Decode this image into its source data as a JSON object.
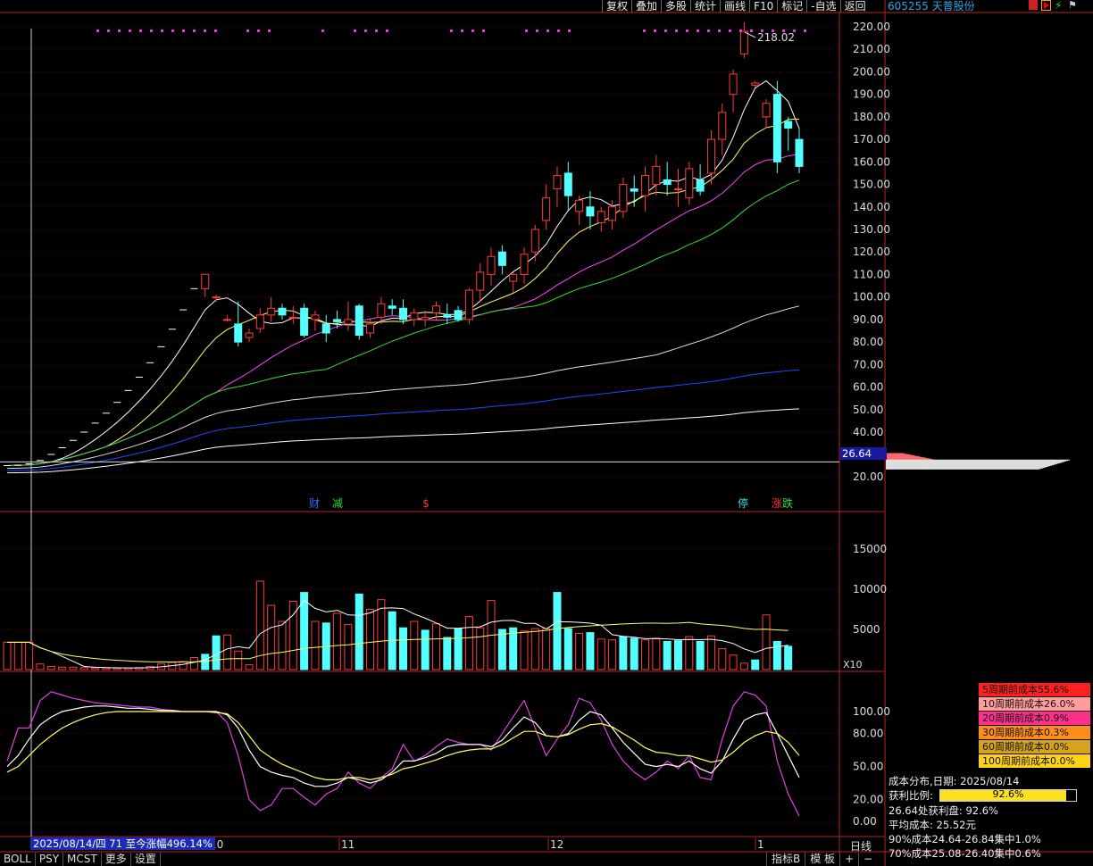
{
  "toolbar": {
    "items": [
      "复权",
      "叠加",
      "多股",
      "统计",
      "画线",
      "F10",
      "标记",
      "-自选",
      "返回"
    ]
  },
  "stock": {
    "title": "605255 天普股份"
  },
  "chart_data": [
    {
      "type": "candlestick",
      "name": "price",
      "yticks": [
        20,
        40,
        50,
        60,
        70,
        80,
        90,
        100,
        110,
        120,
        130,
        140,
        150,
        160,
        170,
        180,
        190,
        200,
        210,
        220
      ],
      "ylim": [
        15,
        225
      ],
      "high_label": "218.02",
      "current_price": "26.64",
      "events": [
        "财",
        "减",
        "$",
        "停",
        "涨",
        "跌"
      ],
      "candles": [
        [
          24.5,
          25.2,
          24.1,
          25.0
        ],
        [
          25.0,
          25.5,
          24.6,
          25.2
        ],
        [
          25.2,
          26.0,
          25.0,
          25.8
        ],
        [
          25.8,
          27.5,
          25.5,
          27.3
        ],
        [
          27.3,
          30.0,
          27.2,
          30.0
        ],
        [
          30.0,
          33.0,
          30.0,
          33.0
        ],
        [
          33.0,
          36.3,
          33.0,
          36.3
        ],
        [
          36.3,
          40.0,
          36.3,
          40.0
        ],
        [
          40.0,
          44.0,
          40.0,
          44.0
        ],
        [
          44.0,
          48.4,
          44.0,
          48.4
        ],
        [
          48.4,
          53.2,
          48.4,
          53.2
        ],
        [
          53.2,
          58.5,
          53.2,
          58.5
        ],
        [
          58.5,
          64.4,
          58.5,
          64.4
        ],
        [
          64.4,
          70.8,
          64.4,
          70.8
        ],
        [
          70.8,
          77.9,
          70.8,
          77.9
        ],
        [
          77.9,
          85.7,
          77.9,
          85.7
        ],
        [
          85.7,
          94.3,
          85.7,
          94.3
        ],
        [
          94.3,
          103.7,
          94.3,
          103.7
        ],
        [
          103.7,
          110.1,
          100.0,
          110.1
        ],
        [
          100,
          101,
          98,
          100
        ],
        [
          90,
          92,
          89,
          90
        ],
        [
          88,
          98,
          78,
          80
        ],
        [
          82,
          86,
          80,
          84
        ],
        [
          86,
          95,
          84,
          92
        ],
        [
          92,
          100,
          89,
          95
        ],
        [
          95,
          97,
          90,
          92
        ],
        [
          91,
          96,
          88,
          91
        ],
        [
          95,
          97,
          82,
          83
        ],
        [
          90,
          94,
          85,
          92
        ],
        [
          88,
          92,
          80,
          84
        ],
        [
          90,
          94,
          86,
          89
        ],
        [
          88,
          98,
          85,
          90
        ],
        [
          96,
          97,
          81,
          83
        ],
        [
          84,
          90,
          82,
          88
        ],
        [
          91,
          100,
          88,
          97
        ],
        [
          96,
          99,
          92,
          95
        ],
        [
          95,
          99,
          88,
          90
        ],
        [
          90,
          95,
          87,
          93
        ],
        [
          90,
          94,
          87,
          91
        ],
        [
          93,
          98,
          90,
          96
        ],
        [
          92,
          97,
          88,
          91
        ],
        [
          94,
          96,
          89,
          90
        ],
        [
          90,
          104,
          88,
          103
        ],
        [
          103,
          115,
          98,
          111
        ],
        [
          110,
          122,
          105,
          118
        ],
        [
          120,
          123,
          110,
          114
        ],
        [
          107,
          111,
          102,
          110
        ],
        [
          110,
          122,
          106,
          119
        ],
        [
          120,
          132,
          116,
          130
        ],
        [
          134,
          150,
          130,
          144
        ],
        [
          148,
          158,
          140,
          154
        ],
        [
          155,
          160,
          138,
          145
        ],
        [
          138,
          145,
          132,
          143
        ],
        [
          140,
          147,
          130,
          136
        ],
        [
          133,
          140,
          129,
          138
        ],
        [
          134,
          143,
          130,
          140
        ],
        [
          138,
          153,
          135,
          150
        ],
        [
          148,
          154,
          140,
          147
        ],
        [
          145,
          158,
          138,
          154
        ],
        [
          150,
          163,
          145,
          158
        ],
        [
          152,
          160,
          145,
          150
        ],
        [
          148,
          157,
          140,
          148
        ],
        [
          144,
          160,
          141,
          157
        ],
        [
          152,
          159,
          145,
          147
        ],
        [
          155,
          174,
          150,
          170
        ],
        [
          170,
          186,
          163,
          182
        ],
        [
          190,
          201,
          182,
          199
        ],
        [
          208,
          222,
          206,
          218
        ],
        [
          194,
          196,
          193,
          195
        ],
        [
          180,
          188,
          175,
          186
        ],
        [
          190,
          196,
          155,
          160
        ],
        [
          178,
          180,
          165,
          175
        ],
        [
          170,
          175,
          155,
          158
        ]
      ],
      "ma_colors": [
        "#ffffff",
        "#ffff66",
        "#ff44ff",
        "#33dd33",
        "#dddddd",
        "#1f4bff",
        "#ffffff"
      ]
    },
    {
      "type": "bar",
      "name": "volume",
      "yticks": [
        5000,
        10000,
        15000
      ],
      "ylim": [
        0,
        18000
      ],
      "multiplier": "X10",
      "values": [
        3400,
        3400,
        3400,
        700,
        400,
        300,
        300,
        250,
        200,
        200,
        180,
        200,
        250,
        400,
        700,
        900,
        1000,
        1500,
        1900,
        4200,
        4300,
        2300,
        600,
        11000,
        8000,
        6000,
        8500,
        9600,
        6000,
        5800,
        7000,
        5600,
        9400,
        7500,
        8700,
        7200,
        5200,
        6000,
        4900,
        5700,
        4000,
        5100,
        6600,
        5200,
        8600,
        5000,
        5200,
        4800,
        5100,
        5100,
        9600,
        5100,
        4500,
        4600,
        3800,
        3700,
        4100,
        3900,
        3700,
        3900,
        3500,
        3600,
        4100,
        3500,
        4200,
        2600,
        1800,
        800,
        1200,
        6800,
        3500,
        2900
      ],
      "up": [
        1,
        1,
        1,
        1,
        1,
        1,
        1,
        1,
        1,
        1,
        1,
        1,
        1,
        1,
        1,
        1,
        1,
        1,
        0,
        0,
        1,
        1,
        1,
        1,
        1,
        1,
        1,
        0,
        1,
        0,
        1,
        1,
        0,
        1,
        1,
        0,
        0,
        1,
        0,
        1,
        0,
        0,
        1,
        1,
        1,
        0,
        0,
        1,
        1,
        1,
        0,
        0,
        1,
        0,
        1,
        1,
        0,
        0,
        1,
        1,
        0,
        0,
        1,
        0,
        1,
        1,
        1,
        1,
        0,
        1,
        0,
        0
      ],
      "ma_colors": [
        "#ffffff",
        "#ffff66"
      ]
    },
    {
      "type": "line",
      "name": "indicator",
      "yticks": [
        0,
        20,
        50,
        80,
        100
      ],
      "ylim": [
        -12,
        130
      ],
      "series": [
        {
          "color": "#dd44dd",
          "values": [
            55,
            85,
            85,
            110,
            118,
            115,
            112,
            110,
            108,
            107,
            106,
            105,
            104,
            104,
            102,
            101,
            100,
            100,
            100,
            100,
            90,
            60,
            20,
            10,
            15,
            30,
            30,
            22,
            15,
            25,
            30,
            45,
            35,
            30,
            40,
            48,
            70,
            55,
            60,
            68,
            75,
            72,
            70,
            70,
            65,
            80,
            95,
            110,
            85,
            60,
            75,
            88,
            112,
            108,
            92,
            70,
            55,
            45,
            38,
            45,
            55,
            48,
            60,
            40,
            38,
            75,
            105,
            118,
            115,
            105,
            55,
            25,
            5
          ]
        },
        {
          "color": "#ffffff",
          "values": [
            50,
            60,
            75,
            88,
            95,
            100,
            102,
            104,
            105,
            105,
            104,
            103,
            103,
            102,
            101,
            101,
            100,
            100,
            100,
            100,
            97,
            85,
            65,
            50,
            45,
            42,
            40,
            35,
            32,
            32,
            35,
            40,
            38,
            35,
            38,
            45,
            55,
            55,
            58,
            62,
            68,
            70,
            70,
            70,
            68,
            74,
            85,
            95,
            90,
            78,
            77,
            80,
            92,
            100,
            97,
            85,
            72,
            62,
            52,
            50,
            52,
            50,
            55,
            48,
            44,
            55,
            75,
            92,
            97,
            99,
            80,
            60,
            40
          ]
        },
        {
          "color": "#ffff66",
          "values": [
            45,
            50,
            60,
            70,
            78,
            85,
            90,
            94,
            97,
            99,
            100,
            100,
            100,
            100,
            100,
            100,
            100,
            100,
            100,
            99,
            98,
            90,
            78,
            65,
            58,
            52,
            48,
            44,
            40,
            38,
            38,
            40,
            40,
            38,
            40,
            43,
            48,
            50,
            53,
            56,
            60,
            63,
            65,
            66,
            66,
            70,
            76,
            82,
            82,
            78,
            77,
            79,
            84,
            88,
            89,
            86,
            80,
            74,
            67,
            63,
            62,
            60,
            60,
            57,
            54,
            56,
            63,
            72,
            78,
            82,
            80,
            72,
            60
          ]
        }
      ]
    }
  ],
  "cost": {
    "tags": [
      {
        "label": "5周期前成本55.6%",
        "color": "#ff2020"
      },
      {
        "label": "10周期前成本26.0%",
        "color": "#ff9c9c"
      },
      {
        "label": "20周期前成本0.9%",
        "color": "#ff2f8e"
      },
      {
        "label": "30周期前成本0.3%",
        "color": "#ff8c1a"
      },
      {
        "label": "60周期前成本0.0%",
        "color": "#d6a41a"
      },
      {
        "label": "100周期前成本0.0%",
        "color": "#ffd21a"
      }
    ],
    "date_line": "成本分布,日期: 2025/08/14",
    "profit_ratio_label": "获利比例:",
    "profit_ratio": "92.6%",
    "profit_fraction": 0.926,
    "lines": [
      "26.64处获利盘: 92.6%",
      "平均成本: 25.52元",
      "90%成本24.64-26.84集中1.0%",
      "70%成本25.08-26.40集中0.6%"
    ]
  },
  "bottom": {
    "date_info": "2025/08/14/四 71 至今涨幅496.14%",
    "month_labels": [
      "10",
      "11",
      "12",
      "1"
    ],
    "tabs": [
      "BOLL",
      "PSY",
      "MCST",
      "更多",
      "设置"
    ],
    "right_tabs": [
      "指标B",
      "模 板",
      "+",
      "−"
    ],
    "period": "日线"
  }
}
